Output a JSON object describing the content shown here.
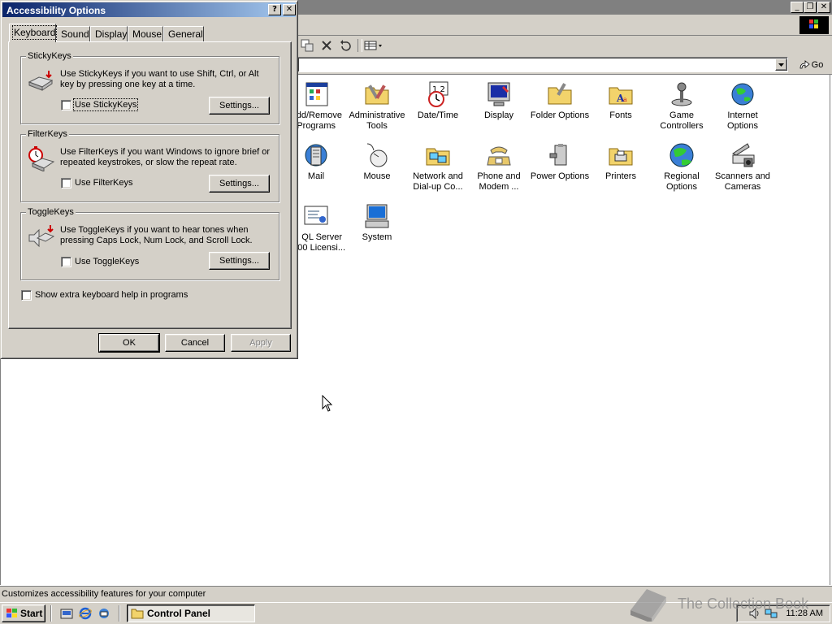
{
  "control_panel": {
    "address_go_label": "Go",
    "status_text": "Customizes accessibility features for your computer",
    "icons": [
      {
        "label": "dd/Remove Programs",
        "line1": "dd/Remove",
        "line2": "Programs",
        "icon": "add-remove-programs-icon"
      },
      {
        "label": "Administrative Tools",
        "line1": "Administrative",
        "line2": "Tools",
        "icon": "administrative-tools-icon"
      },
      {
        "label": "Date/Time",
        "line1": "Date/Time",
        "line2": "",
        "icon": "date-time-icon"
      },
      {
        "label": "Display",
        "line1": "Display",
        "line2": "",
        "icon": "display-icon"
      },
      {
        "label": "Folder Options",
        "line1": "Folder Options",
        "line2": "",
        "icon": "folder-options-icon"
      },
      {
        "label": "Fonts",
        "line1": "Fonts",
        "line2": "",
        "icon": "fonts-icon"
      },
      {
        "label": "Game Controllers",
        "line1": "Game",
        "line2": "Controllers",
        "icon": "game-controllers-icon"
      },
      {
        "label": "Internet Options",
        "line1": "Internet",
        "line2": "Options",
        "icon": "internet-options-icon"
      },
      {
        "label": "Mail",
        "line1": "Mail",
        "line2": "",
        "icon": "mail-icon"
      },
      {
        "label": "Mouse",
        "line1": "Mouse",
        "line2": "",
        "icon": "mouse-icon"
      },
      {
        "label": "Network and Dial-up Co...",
        "line1": "Network and",
        "line2": "Dial-up Co...",
        "icon": "network-icon"
      },
      {
        "label": "Phone and Modem ...",
        "line1": "Phone and",
        "line2": "Modem ...",
        "icon": "phone-modem-icon"
      },
      {
        "label": "Power Options",
        "line1": "Power Options",
        "line2": "",
        "icon": "power-options-icon"
      },
      {
        "label": "Printers",
        "line1": "Printers",
        "line2": "",
        "icon": "printers-icon"
      },
      {
        "label": "Regional Options",
        "line1": "Regional",
        "line2": "Options",
        "icon": "regional-options-icon"
      },
      {
        "label": "Scanners and Cameras",
        "line1": "Scanners and",
        "line2": "Cameras",
        "icon": "scanners-cameras-icon"
      },
      {
        "label": "QL Server 00 Licensi...",
        "line1": "QL Server",
        "line2": "00 Licensi...",
        "icon": "sql-licensing-icon"
      },
      {
        "label": "System",
        "line1": "System",
        "line2": "",
        "icon": "system-icon"
      }
    ]
  },
  "dialog": {
    "title": "Accessibility Options",
    "help_glyph": "?",
    "close_glyph": "✕",
    "tabs": [
      "Keyboard",
      "Sound",
      "Display",
      "Mouse",
      "General"
    ],
    "active_tab": "Keyboard",
    "stickykeys": {
      "group_label": "StickyKeys",
      "description": "Use StickyKeys if you want to use Shift, Ctrl, or Alt key by pressing one key at a time.",
      "checkbox_label": "Use StickyKeys",
      "checked": false,
      "settings_label": "Settings..."
    },
    "filterkeys": {
      "group_label": "FilterKeys",
      "description": "Use FilterKeys if you want Windows to ignore brief or repeated keystrokes, or slow the repeat rate.",
      "checkbox_label": "Use FilterKeys",
      "checked": false,
      "settings_label": "Settings..."
    },
    "togglekeys": {
      "group_label": "ToggleKeys",
      "description": "Use ToggleKeys if you want to hear tones when pressing Caps Lock, Num Lock, and Scroll Lock.",
      "checkbox_label": "Use ToggleKeys",
      "checked": false,
      "settings_label": "Settings..."
    },
    "extra_help_label": "Show extra keyboard help in programs",
    "ok_label": "OK",
    "cancel_label": "Cancel",
    "apply_label": "Apply"
  },
  "taskbar": {
    "start_label": "Start",
    "task_label": "Control Panel",
    "clock": "11:28 AM"
  },
  "watermark": "The Collection Book",
  "colors": {
    "titlebar_active_start": "#0a246a",
    "titlebar_active_end": "#a6caf0",
    "face": "#d4d0c8",
    "inactive_title": "#808080"
  }
}
